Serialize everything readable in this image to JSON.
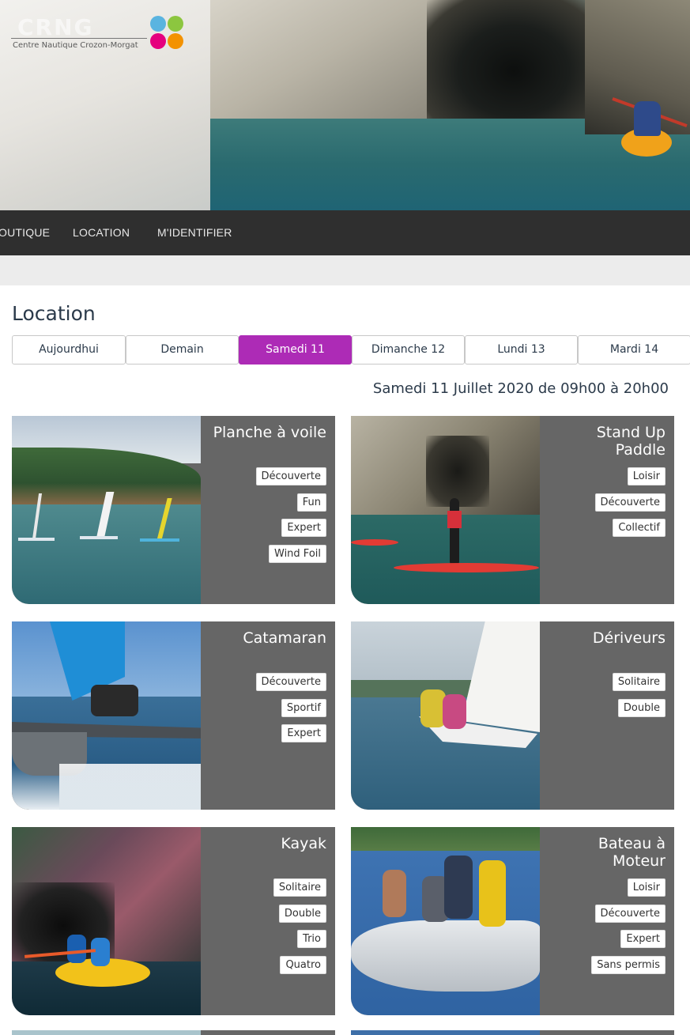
{
  "header": {
    "logo_word": "CRNG",
    "logo_subtitle": "Centre Nautique Crozon-Morgat",
    "logo_dot_colors": [
      "#5ab4e0",
      "#8cc63f",
      "#e5007e",
      "#f39200"
    ]
  },
  "nav": {
    "items": [
      "OUTIQUE",
      "LOCATION",
      "M'IDENTIFIER"
    ]
  },
  "page": {
    "title": "Location",
    "date_line": "Samedi 11 Juillet 2020 de 09h00 à 20h00"
  },
  "tabs": [
    {
      "label": "Aujourdhui",
      "active": false
    },
    {
      "label": "Demain",
      "active": false
    },
    {
      "label": "Samedi 11",
      "active": true
    },
    {
      "label": "Dimanche 12",
      "active": false
    },
    {
      "label": "Lundi 13",
      "active": false
    },
    {
      "label": "Mardi 14",
      "active": false
    }
  ],
  "colors": {
    "accent": "#ad2bb6",
    "nav_bg": "#2f2f2f",
    "card_panel": "#666666"
  },
  "cards": [
    {
      "title": "Planche à voile",
      "options": [
        "Découverte",
        "Fun",
        "Expert",
        "Wind Foil"
      ]
    },
    {
      "title": "Stand Up Paddle",
      "options": [
        "Loisir",
        "Découverte",
        "Collectif"
      ]
    },
    {
      "title": "Catamaran",
      "options": [
        "Découverte",
        "Sportif",
        "Expert"
      ]
    },
    {
      "title": "Dériveurs",
      "options": [
        "Solitaire",
        "Double"
      ]
    },
    {
      "title": "Kayak",
      "options": [
        "Solitaire",
        "Double",
        "Trio",
        "Quatro"
      ]
    },
    {
      "title": "Bateau à Moteur",
      "options": [
        "Loisir",
        "Découverte",
        "Expert",
        "Sans permis"
      ]
    }
  ]
}
